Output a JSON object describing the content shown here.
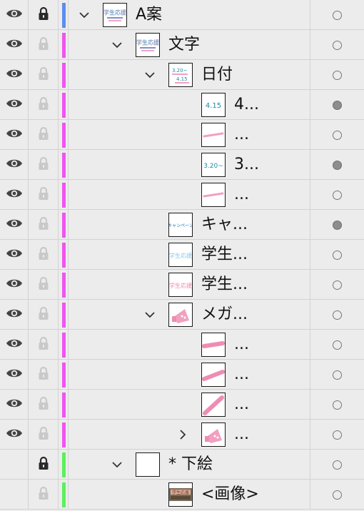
{
  "colors": {
    "blue_bar": "#5b8cf0",
    "magenta_bar": "#f054f0",
    "green_bar": "#5cf05c"
  },
  "layers": [
    {
      "name": "A案",
      "thumb": "campaign-a",
      "indent": 0,
      "chevron": "down",
      "visible": true,
      "lock": "locked",
      "color": "blue",
      "targeted": false
    },
    {
      "name": "文字",
      "thumb": "campaign-a",
      "indent": 1,
      "chevron": "down",
      "visible": true,
      "lock": "faded",
      "color": "magenta",
      "targeted": false
    },
    {
      "name": "日付",
      "thumb": "date-combo",
      "indent": 2,
      "chevron": "down",
      "visible": true,
      "lock": "faded",
      "color": "magenta",
      "targeted": false
    },
    {
      "name": "4...",
      "thumb": "date-415",
      "indent": 3,
      "chevron": "none",
      "visible": true,
      "lock": "faded",
      "color": "magenta",
      "targeted": true
    },
    {
      "name": "...",
      "thumb": "pink-stroke-thin",
      "indent": 3,
      "chevron": "none",
      "visible": true,
      "lock": "faded",
      "color": "magenta",
      "targeted": false
    },
    {
      "name": "3...",
      "thumb": "date-320",
      "indent": 3,
      "chevron": "none",
      "visible": true,
      "lock": "faded",
      "color": "magenta",
      "targeted": true
    },
    {
      "name": "...",
      "thumb": "pink-stroke-thin",
      "indent": 3,
      "chevron": "none",
      "visible": true,
      "lock": "faded",
      "color": "magenta",
      "targeted": false
    },
    {
      "name": "キャ...",
      "thumb": "campaign-text",
      "indent": 2,
      "chevron": "none",
      "visible": true,
      "lock": "faded",
      "color": "magenta",
      "targeted": true
    },
    {
      "name": "学生...",
      "thumb": "gakusei-blue",
      "indent": 2,
      "chevron": "none",
      "visible": true,
      "lock": "faded",
      "color": "magenta",
      "targeted": false
    },
    {
      "name": "学生...",
      "thumb": "gakusei-pink",
      "indent": 2,
      "chevron": "none",
      "visible": true,
      "lock": "faded",
      "color": "magenta",
      "targeted": false
    },
    {
      "name": "メガ...",
      "thumb": "megaphone",
      "indent": 2,
      "chevron": "down",
      "visible": true,
      "lock": "faded",
      "color": "magenta",
      "targeted": false
    },
    {
      "name": "...",
      "thumb": "pink-stroke-flat",
      "indent": 3,
      "chevron": "none",
      "visible": true,
      "lock": "faded",
      "color": "magenta",
      "targeted": false
    },
    {
      "name": "...",
      "thumb": "pink-stroke-slant",
      "indent": 3,
      "chevron": "none",
      "visible": true,
      "lock": "faded",
      "color": "magenta",
      "targeted": false
    },
    {
      "name": "...",
      "thumb": "pink-stroke-steep",
      "indent": 3,
      "chevron": "none",
      "visible": true,
      "lock": "faded",
      "color": "magenta",
      "targeted": false
    },
    {
      "name": "...",
      "thumb": "megaphone",
      "indent": 3,
      "chevron": "right",
      "visible": true,
      "lock": "faded",
      "color": "magenta",
      "targeted": false
    },
    {
      "name": "* 下絵",
      "thumb": "blank",
      "indent": 1,
      "chevron": "down",
      "visible": false,
      "lock": "locked",
      "color": "green",
      "targeted": false
    },
    {
      "name": "<画像>",
      "thumb": "photo",
      "indent": 2,
      "chevron": "none",
      "visible": false,
      "lock": "faded",
      "color": "green",
      "targeted": false
    }
  ]
}
